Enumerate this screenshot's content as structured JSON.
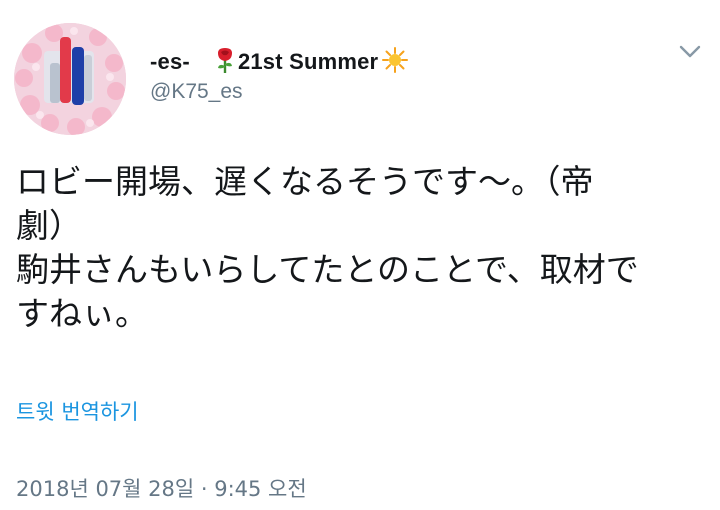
{
  "user": {
    "display_name_prefix": "-es-",
    "display_name_suffix": "21st Summer",
    "handle": "@K75_es",
    "emoji_1": "rose-emoji",
    "emoji_2": "sun-sparkle-emoji"
  },
  "tweet": {
    "lines": [
      "ロビー開場、遅くなるそうです〜。（帝",
      "劇）",
      "駒井さんもいらしてたとのことで、取材で",
      "すねぃ。"
    ]
  },
  "translate_label": "트윗 번역하기",
  "timestamp": "2018년 07월 28일 · 9:45 오전",
  "colors": {
    "text": "#14171a",
    "secondary": "#657786",
    "link": "#1b95e0"
  }
}
